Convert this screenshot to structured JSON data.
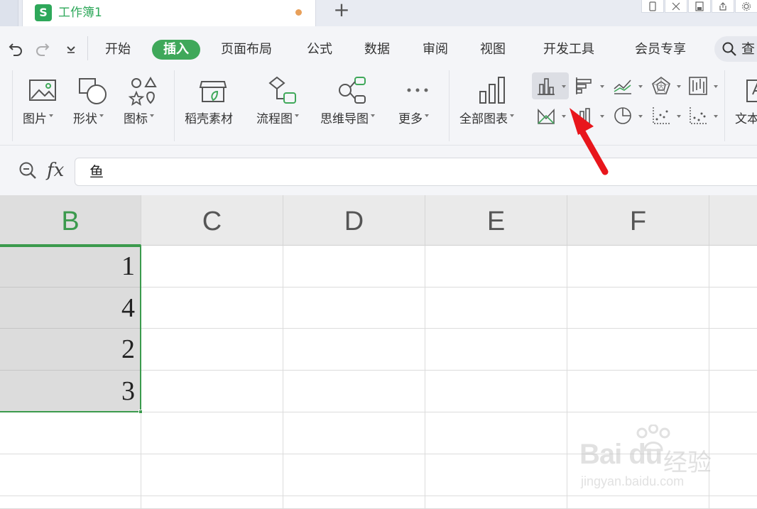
{
  "titlebar": {
    "app_badge": "S",
    "doc_title": "工作簿1",
    "new_tab": "+"
  },
  "menu": {
    "items": [
      {
        "label": "开始"
      },
      {
        "label": "插入",
        "active": true
      },
      {
        "label": "页面布局"
      },
      {
        "label": "公式"
      },
      {
        "label": "数据"
      },
      {
        "label": "审阅"
      },
      {
        "label": "视图"
      },
      {
        "label": "开发工具"
      },
      {
        "label": "会员专享"
      }
    ],
    "search_text": "查"
  },
  "ribbon": {
    "picture": "图片",
    "shape": "形状",
    "icon": "图标",
    "docer_assets": "稻壳素材",
    "flowchart": "流程图",
    "mindmap": "思维导图",
    "more": "更多",
    "all_charts": "全部图表",
    "textbox": "文本"
  },
  "formula_bar": {
    "fx": "fx",
    "value": "鱼"
  },
  "sheet": {
    "columns": [
      "B",
      "C",
      "D",
      "E",
      "F"
    ],
    "selected_column": "B",
    "column_b_values": [
      "1",
      "4",
      "2",
      "3"
    ]
  },
  "colors": {
    "accent": "#3fa85a",
    "annotation_arrow": "#e8161c"
  },
  "watermark": {
    "brand": "Bai du",
    "brand_cn": "经验",
    "url": "jingyan.baidu.com"
  }
}
